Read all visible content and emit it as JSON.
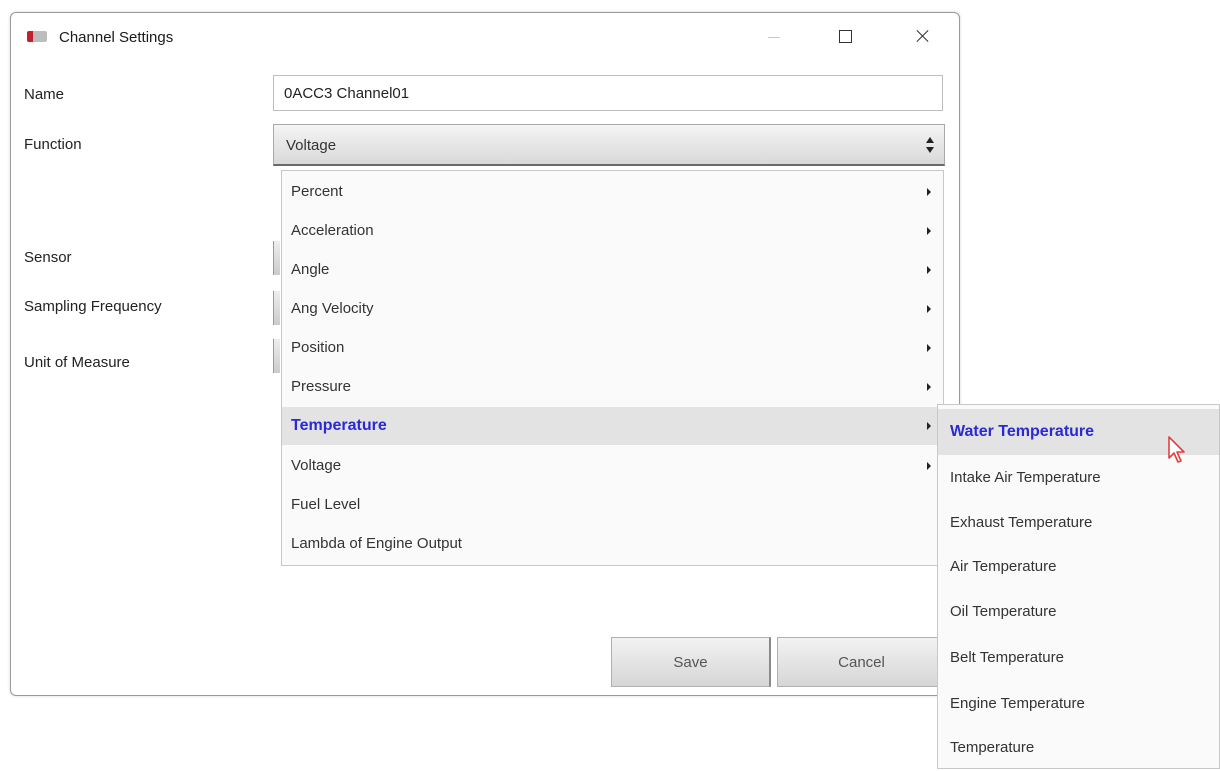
{
  "window": {
    "title": "Channel Settings",
    "controls": [
      "minimize-icon",
      "maximize-icon",
      "close-icon"
    ]
  },
  "form": {
    "name_label": "Name",
    "name_value": "0ACC3 Channel01",
    "function_label": "Function",
    "function_value": "Voltage",
    "sensor_label": "Sensor",
    "sampling_label": "Sampling Frequency",
    "unit_label": "Unit of Measure"
  },
  "buttons": {
    "save": "Save",
    "cancel": "Cancel"
  },
  "function_menu": {
    "items": [
      {
        "label": "Percent",
        "submenu": true
      },
      {
        "label": "Acceleration",
        "submenu": true
      },
      {
        "label": "Angle",
        "submenu": true
      },
      {
        "label": "Ang Velocity",
        "submenu": true
      },
      {
        "label": "Position",
        "submenu": true
      },
      {
        "label": "Pressure",
        "submenu": true
      },
      {
        "label": "Temperature",
        "submenu": true,
        "active": true
      },
      {
        "label": "Voltage",
        "submenu": true
      },
      {
        "label": "Fuel Level",
        "submenu": false
      },
      {
        "label": "Lambda of Engine Output",
        "submenu": false
      }
    ]
  },
  "temperature_submenu": {
    "items": [
      {
        "label": "Water Temperature",
        "active": true
      },
      {
        "label": "Intake Air Temperature"
      },
      {
        "label": "Exhaust Temperature"
      },
      {
        "label": "Air Temperature"
      },
      {
        "label": "Oil Temperature"
      },
      {
        "label": "Belt Temperature"
      },
      {
        "label": "Engine Temperature"
      },
      {
        "label": "Temperature"
      }
    ]
  },
  "colors": {
    "highlight_text": "#2a2ad4",
    "highlight_bg": "#e3e3e3",
    "cursor": "#e24040"
  }
}
